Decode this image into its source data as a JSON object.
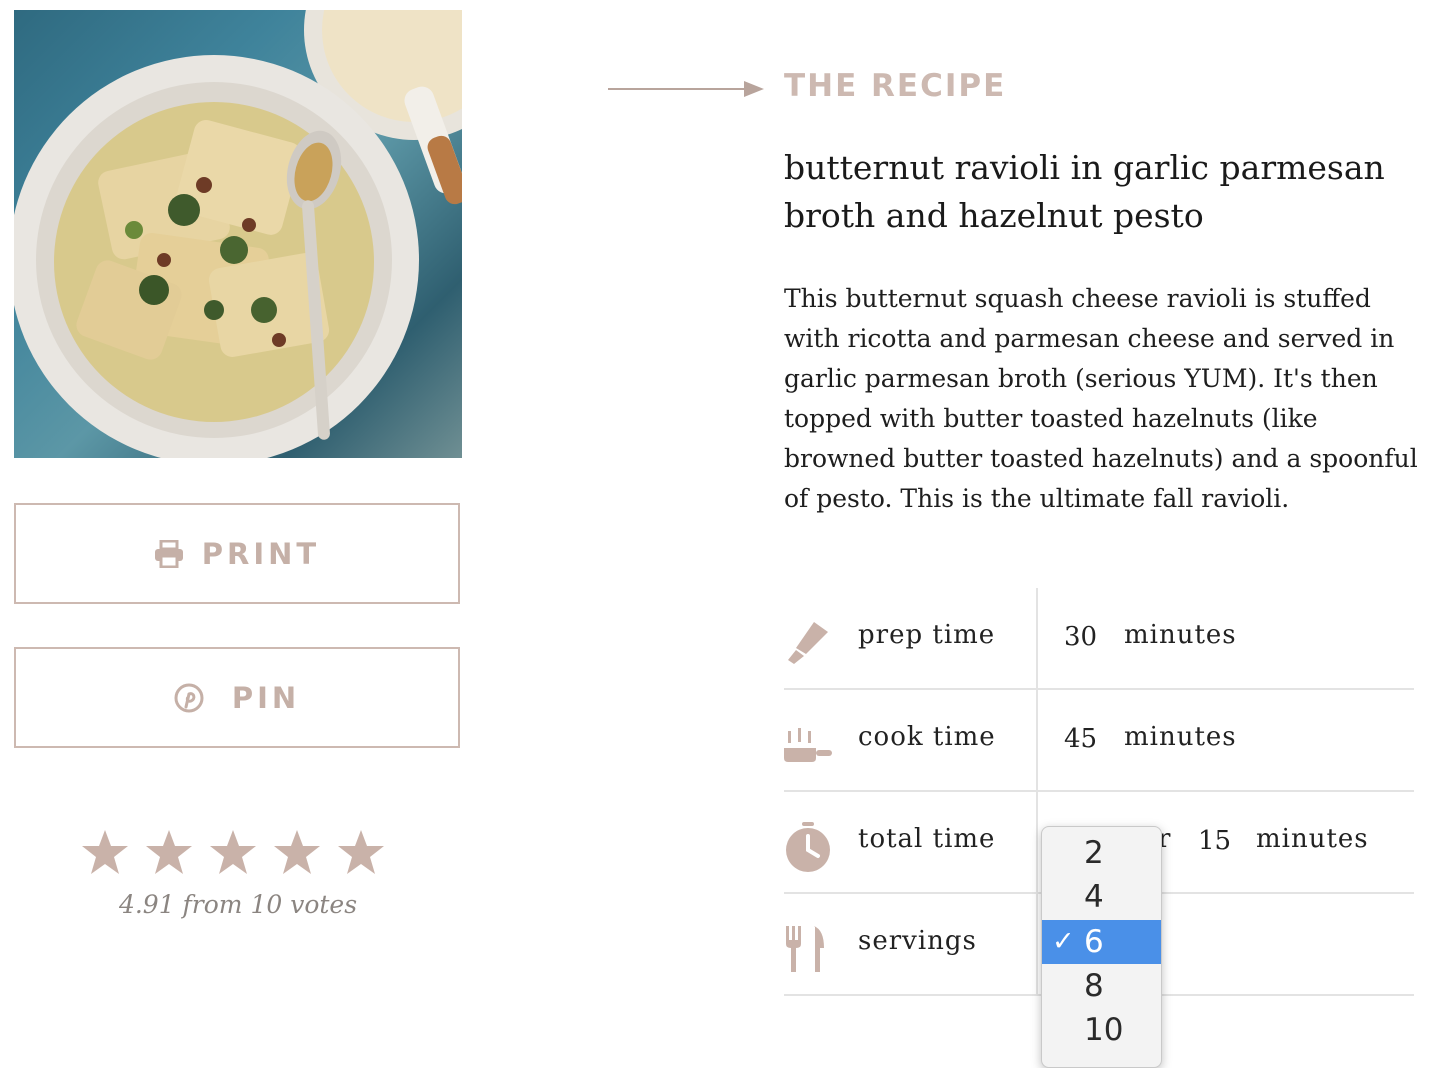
{
  "left": {
    "print_label": "PRINT",
    "pin_label": "PIN",
    "rating": {
      "stars": 5,
      "value": 4.91,
      "text": "4.91 from 10 votes"
    },
    "icons": {
      "print": "printer-icon",
      "pin": "pinterest-icon",
      "star": "star-icon"
    }
  },
  "recipe": {
    "eyebrow": "THE RECIPE",
    "title": "butternut ravioli in garlic parmesan broth and hazelnut pesto",
    "description": "This butternut squash cheese ravioli is stuffed with ricotta and parmesan cheese and served in garlic parmesan broth (serious YUM). It's then topped with butter toasted hazelnuts (like browned butter toasted hazelnuts) and a spoonful of pesto. This is the ultimate fall ravioli.",
    "times": [
      {
        "label": "prep time",
        "value": "30",
        "unit": "minutes",
        "icon": "knife-icon"
      },
      {
        "label": "cook time",
        "value": "45",
        "unit": "minutes",
        "icon": "pan-icon"
      },
      {
        "label": "total time",
        "partial": "r",
        "value": "15",
        "unit": "minutes",
        "icon": "clock-icon"
      },
      {
        "label": "servings",
        "icon": "utensils-icon"
      }
    ],
    "servings_options": [
      "2",
      "4",
      "6",
      "8",
      "10"
    ],
    "servings_selected": "6",
    "check_glyph": "✓"
  },
  "colors": {
    "accent": "#cdb9b1",
    "selection": "#4a90e8"
  }
}
